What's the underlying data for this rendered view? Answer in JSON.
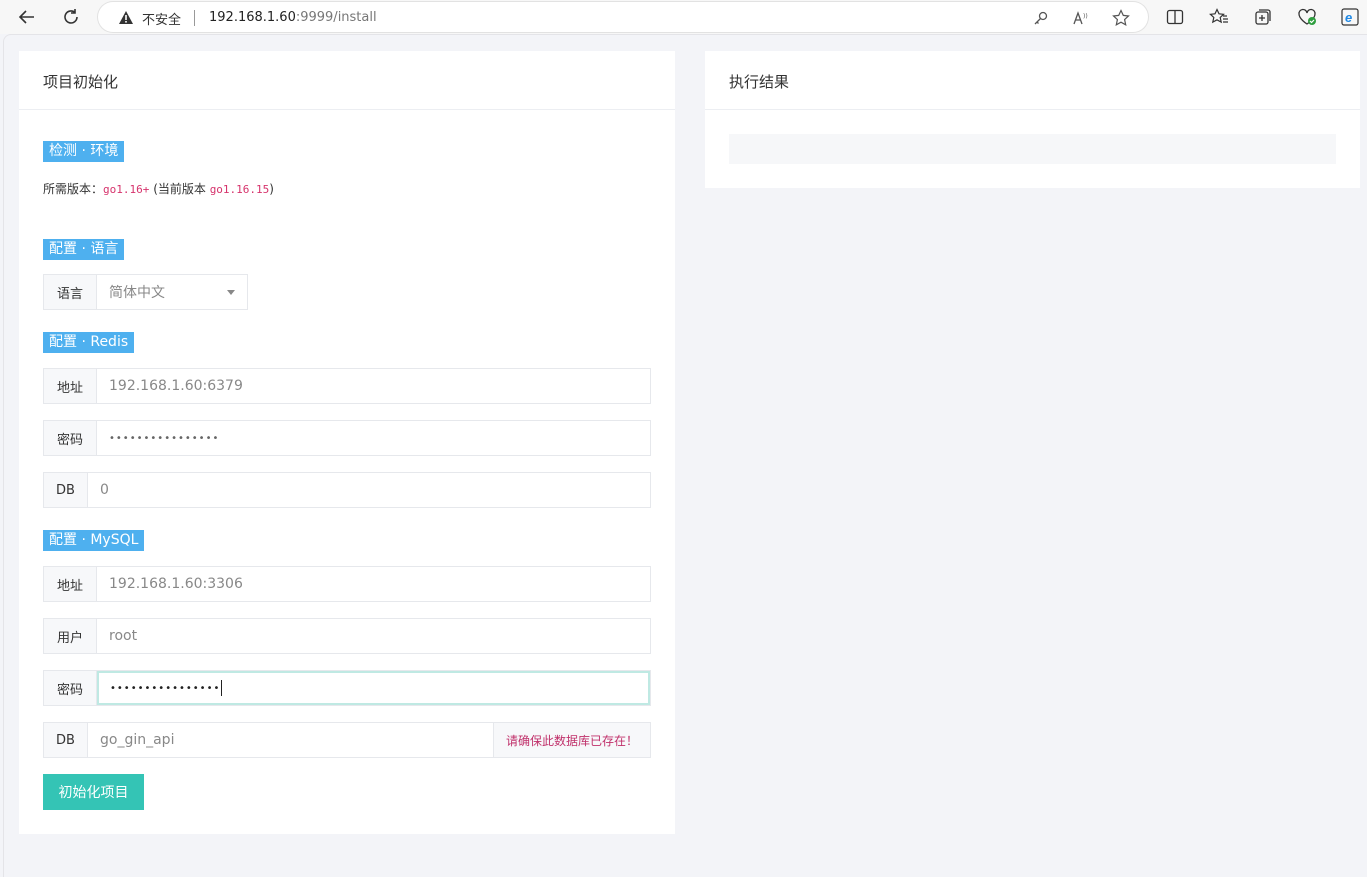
{
  "browser": {
    "insecure_label": "不安全",
    "url_host": "192.168.1.60",
    "url_rest": ":9999/install"
  },
  "left_card": {
    "title": "项目初始化",
    "env": {
      "tag": "检测 · 环境",
      "required_label": "所需版本：",
      "required_version": "go1.16+",
      "current_open": " (当前版本 ",
      "current_version": "go1.16.15",
      "current_close": ")"
    },
    "lang": {
      "tag": "配置 · 语言",
      "label": "语言",
      "value": "简体中文"
    },
    "redis": {
      "tag": "配置 · Redis",
      "addr_label": "地址",
      "addr_value": "192.168.1.60:6379",
      "pass_label": "密码",
      "pass_value": "••••••••••••••••",
      "db_label": "DB",
      "db_value": "0"
    },
    "mysql": {
      "tag": "配置 · MySQL",
      "addr_label": "地址",
      "addr_value": "192.168.1.60:3306",
      "user_label": "用户",
      "user_value": "root",
      "pass_label": "密码",
      "pass_value": "••••••••••••••••",
      "db_label": "DB",
      "db_value": "go_gin_api",
      "db_hint": "请确保此数据库已存在！"
    },
    "submit_label": "初始化项目"
  },
  "right_card": {
    "title": "执行结果"
  },
  "colors": {
    "tag_bg": "#4eb0ef",
    "button_bg": "#34c4b5",
    "hint": "#c0306a",
    "code": "#d6336c"
  }
}
